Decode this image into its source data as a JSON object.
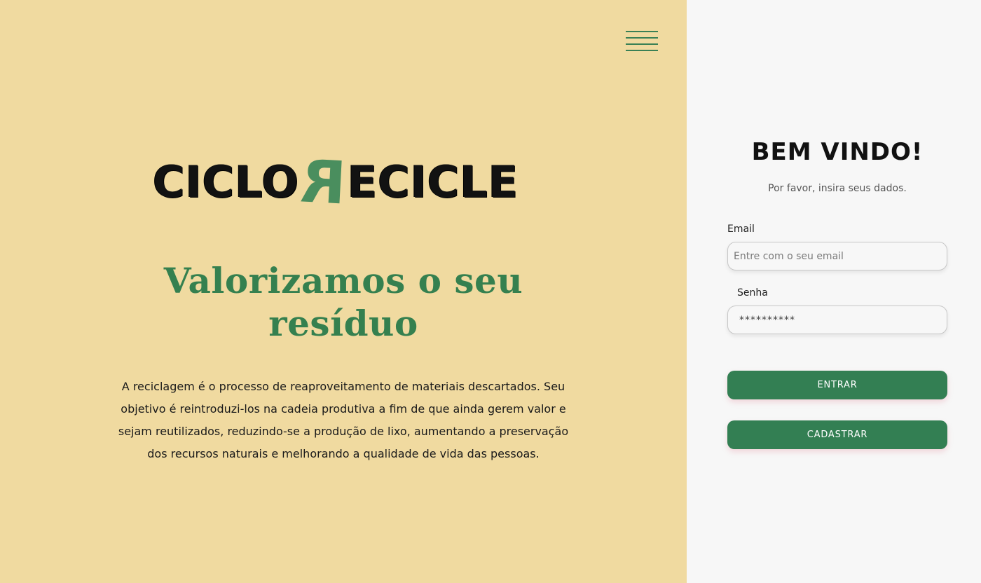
{
  "hero": {
    "logo": {
      "prefix": "CICLO",
      "mark": "R",
      "suffix": "ECICLE"
    },
    "headline": "Valorizamos o seu resíduo",
    "description": "A reciclagem é o processo de reaproveitamento de materiais descartados. Seu objetivo é reintroduzi-los na cadeia produtiva a fim de que ainda gerem valor e sejam reutilizados, reduzindo-se a produção de lixo, aumentando a preservação dos recursos naturais e melhorando a qualidade de vida das pessoas."
  },
  "menu": {
    "icon": "hamburger-menu-icon"
  },
  "login": {
    "title": "BEM VINDO!",
    "subtitle": "Por favor, insira seus dados.",
    "email_label": "Email",
    "email_placeholder": "Entre com o seu email",
    "password_label": "Senha",
    "password_value": "**********",
    "login_button": "ENTRAR",
    "register_button": "CADASTRAR"
  },
  "colors": {
    "left_background": "#f0daa0",
    "right_background": "#f7f7f7",
    "brand_green": "#337f53",
    "headline_green": "#35804f"
  }
}
